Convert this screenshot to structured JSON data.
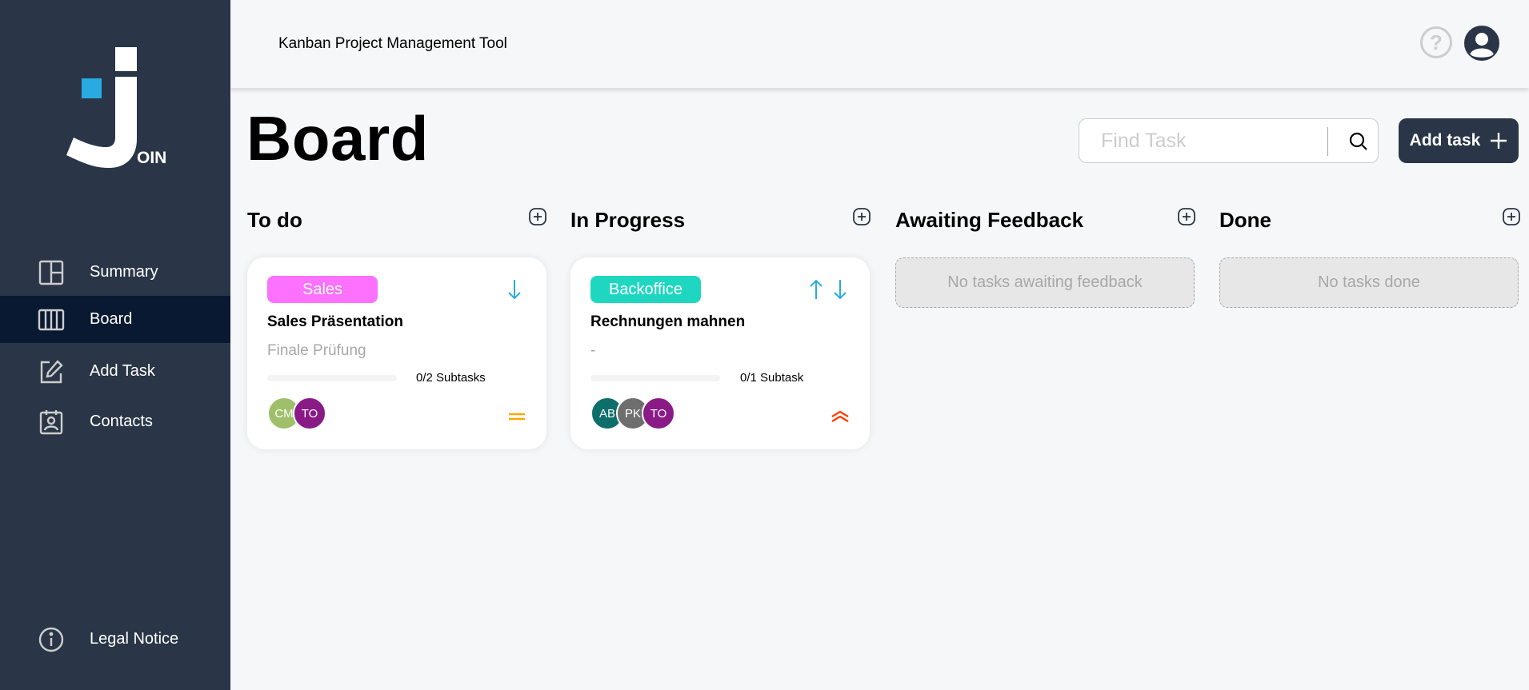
{
  "app": {
    "header_title": "Kanban Project Management Tool",
    "logo_text": "OIN",
    "help_symbol": "?"
  },
  "sidebar": {
    "items": [
      {
        "label": "Summary",
        "icon": "summary-icon",
        "active": false
      },
      {
        "label": "Board",
        "icon": "board-icon",
        "active": true
      },
      {
        "label": "Add Task",
        "icon": "add-task-icon",
        "active": false
      },
      {
        "label": "Contacts",
        "icon": "contacts-icon",
        "active": false
      }
    ],
    "legal": {
      "label": "Legal Notice",
      "icon": "info-icon"
    }
  },
  "board": {
    "title": "Board",
    "search_placeholder": "Find Task",
    "add_task_label": "Add task"
  },
  "columns": [
    {
      "title": "To do"
    },
    {
      "title": "In Progress"
    },
    {
      "title": "Awaiting Feedback",
      "empty_text": "No tasks awaiting feedback"
    },
    {
      "title": "Done",
      "empty_text": "No tasks done"
    }
  ],
  "cards": [
    {
      "tag": "Sales",
      "tag_color": "#fc71ff",
      "title": "Sales Präsentation",
      "description": "Finale Prüfung",
      "subtasks_text": "0/2 Subtasks",
      "progress": 0,
      "assignees": [
        {
          "initials": "CM",
          "color": "#9fbf6a"
        },
        {
          "initials": "TO",
          "color": "#8a1a86"
        }
      ],
      "priority": "medium",
      "priority_color": "#ffa800"
    },
    {
      "tag": "Backoffice",
      "tag_color": "#1fd7c1",
      "title": "Rechnungen mahnen",
      "description": "-",
      "subtasks_text": "0/1 Subtask",
      "progress": 0,
      "assignees": [
        {
          "initials": "AB",
          "color": "#0e6f6a"
        },
        {
          "initials": "PK",
          "color": "#6e6e6e"
        },
        {
          "initials": "TO",
          "color": "#8a1a86"
        }
      ],
      "priority": "urgent",
      "priority_color": "#ff3d00"
    }
  ],
  "colors": {
    "sidebar": "#2a3647",
    "active_nav": "#091931",
    "accent": "#29abe2"
  }
}
